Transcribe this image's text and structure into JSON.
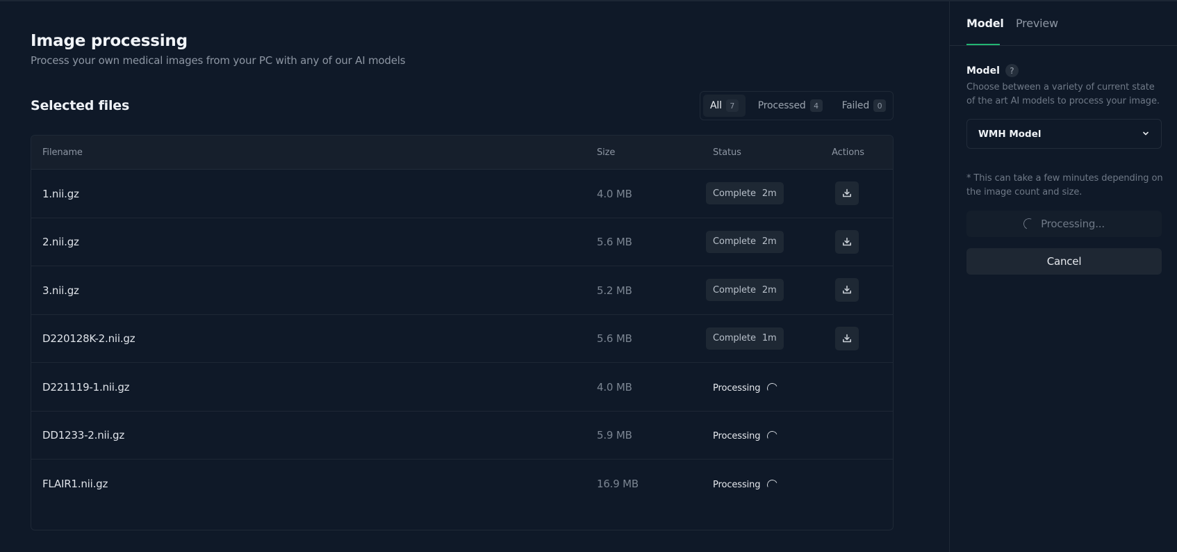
{
  "header": {
    "title": "Image processing",
    "subtitle": "Process your own medical images from your PC with any of our AI models"
  },
  "files": {
    "section_title": "Selected files",
    "filters": [
      {
        "label": "All",
        "count": "7",
        "active": true
      },
      {
        "label": "Processed",
        "count": "4",
        "active": false
      },
      {
        "label": "Failed",
        "count": "0",
        "active": false
      }
    ],
    "columns": {
      "filename": "Filename",
      "size": "Size",
      "status": "Status",
      "actions": "Actions"
    },
    "rows": [
      {
        "filename": "1.nii.gz",
        "size": "4.0 MB",
        "status": "Complete",
        "duration": "2m",
        "action_icon": "download-icon"
      },
      {
        "filename": "2.nii.gz",
        "size": "5.6 MB",
        "status": "Complete",
        "duration": "2m",
        "action_icon": "download-icon"
      },
      {
        "filename": "3.nii.gz",
        "size": "5.2 MB",
        "status": "Complete",
        "duration": "2m",
        "action_icon": "download-icon"
      },
      {
        "filename": "D220128K-2.nii.gz",
        "size": "5.6 MB",
        "status": "Complete",
        "duration": "1m",
        "action_icon": "download-icon"
      },
      {
        "filename": "D221119-1.nii.gz",
        "size": "4.0 MB",
        "status": "Processing",
        "duration": "",
        "action_icon": ""
      },
      {
        "filename": "DD1233-2.nii.gz",
        "size": "5.9 MB",
        "status": "Processing",
        "duration": "",
        "action_icon": ""
      },
      {
        "filename": "FLAIR1.nii.gz",
        "size": "16.9 MB",
        "status": "Processing",
        "duration": "",
        "action_icon": ""
      }
    ]
  },
  "panel": {
    "tabs": [
      {
        "label": "Model",
        "active": true
      },
      {
        "label": "Preview",
        "active": false
      }
    ],
    "model_label": "Model",
    "help_icon": "?",
    "model_description": "Choose between a variety of current state of the art AI models to process your image.",
    "model_selected": "WMH Model",
    "note": "* This can take a few minutes depending on the image count and size.",
    "processing_button": "Processing...",
    "cancel_button": "Cancel"
  },
  "colors": {
    "background": "#0f1928",
    "accent": "#22b573",
    "muted_text": "#8d96a3",
    "badge_bg": "#1e2834"
  }
}
